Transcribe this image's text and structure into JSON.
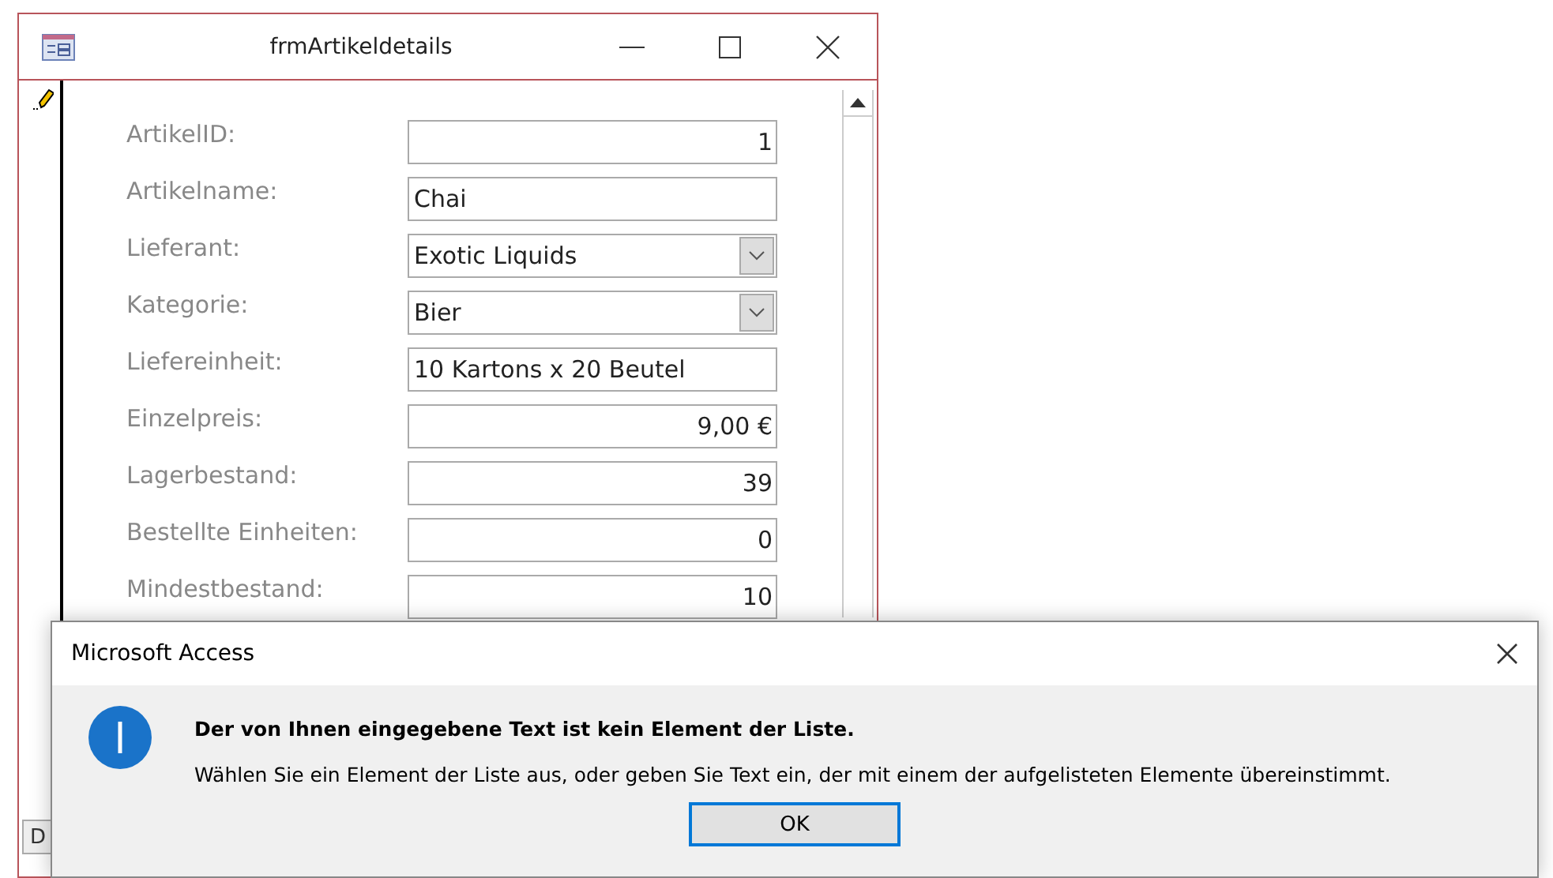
{
  "form_window": {
    "title": "frmArtikeldetails",
    "record_nav": "D",
    "fields": [
      {
        "label": "ArtikelID:",
        "kind": "number",
        "value": "1"
      },
      {
        "label": "Artikelname:",
        "kind": "text",
        "value": "Chai"
      },
      {
        "label": "Lieferant:",
        "kind": "combo",
        "value": "Exotic Liquids"
      },
      {
        "label": "Kategorie:",
        "kind": "combo",
        "value": "Bier"
      },
      {
        "label": "Liefereinheit:",
        "kind": "text",
        "value": "10 Kartons x 20 Beutel"
      },
      {
        "label": "Einzelpreis:",
        "kind": "number",
        "value": "9,00 €"
      },
      {
        "label": "Lagerbestand:",
        "kind": "number",
        "value": "39"
      },
      {
        "label": "Bestellte Einheiten:",
        "kind": "number",
        "value": "0"
      },
      {
        "label": "Mindestbestand:",
        "kind": "number",
        "value": "10"
      }
    ]
  },
  "dialog": {
    "title": "Microsoft Access",
    "heading": "Der von Ihnen eingegebene Text ist kein Element der Liste.",
    "message": "Wählen Sie ein Element der Liste aus, oder geben Sie Text ein, der mit einem der aufgelisteten Elemente übereinstimmt.",
    "button": "OK"
  }
}
